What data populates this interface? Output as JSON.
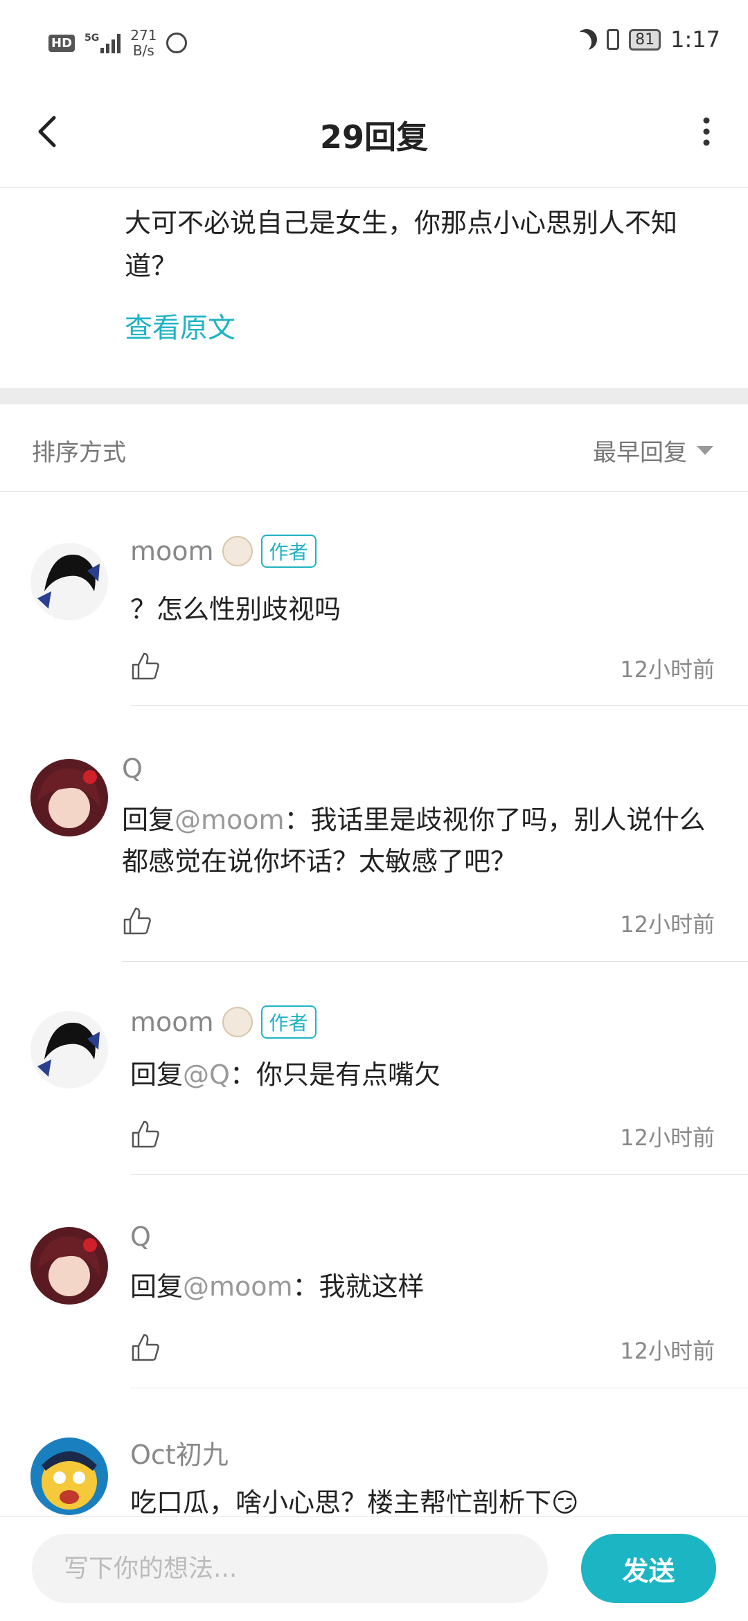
{
  "status_bar": {
    "network_badge": "HD",
    "signal_label": "5G",
    "speed_value": "271",
    "speed_unit": "B/s",
    "battery": "81",
    "time": "1:17"
  },
  "header": {
    "title": "29回复"
  },
  "original_post": {
    "text": "大可不必说自己是女生，你那点小心思别人不知道？",
    "view_original_label": "查看原文"
  },
  "sort": {
    "label": "排序方式",
    "value": "最早回复"
  },
  "comments": [
    {
      "name": "moom",
      "author_badge": "作者",
      "reply_prefix": "",
      "mention": "",
      "text": "？怎么性别歧视吗",
      "time": "12小时前"
    },
    {
      "name": "Q",
      "author_badge": "",
      "reply_prefix": "回复",
      "mention": "@moom",
      "text": "：我话里是歧视你了吗，别人说什么都感觉在说你坏话？太敏感了吧？",
      "time": "12小时前"
    },
    {
      "name": "moom",
      "author_badge": "作者",
      "reply_prefix": "回复",
      "mention": "@Q",
      "text": "：你只是有点嘴欠",
      "time": "12小时前"
    },
    {
      "name": "Q",
      "author_badge": "",
      "reply_prefix": "回复",
      "mention": "@moom",
      "text": "：我就这样",
      "time": "12小时前"
    },
    {
      "name": "Oct初九",
      "author_badge": "",
      "reply_prefix": "",
      "mention": "",
      "text": "吃口瓜，啥小心思？楼主帮忙剖析下😏",
      "time": ""
    }
  ],
  "composer": {
    "placeholder": "写下你的想法...",
    "send_label": "发送"
  },
  "colors": {
    "accent": "#1cb5c4",
    "mention": "#999999"
  }
}
